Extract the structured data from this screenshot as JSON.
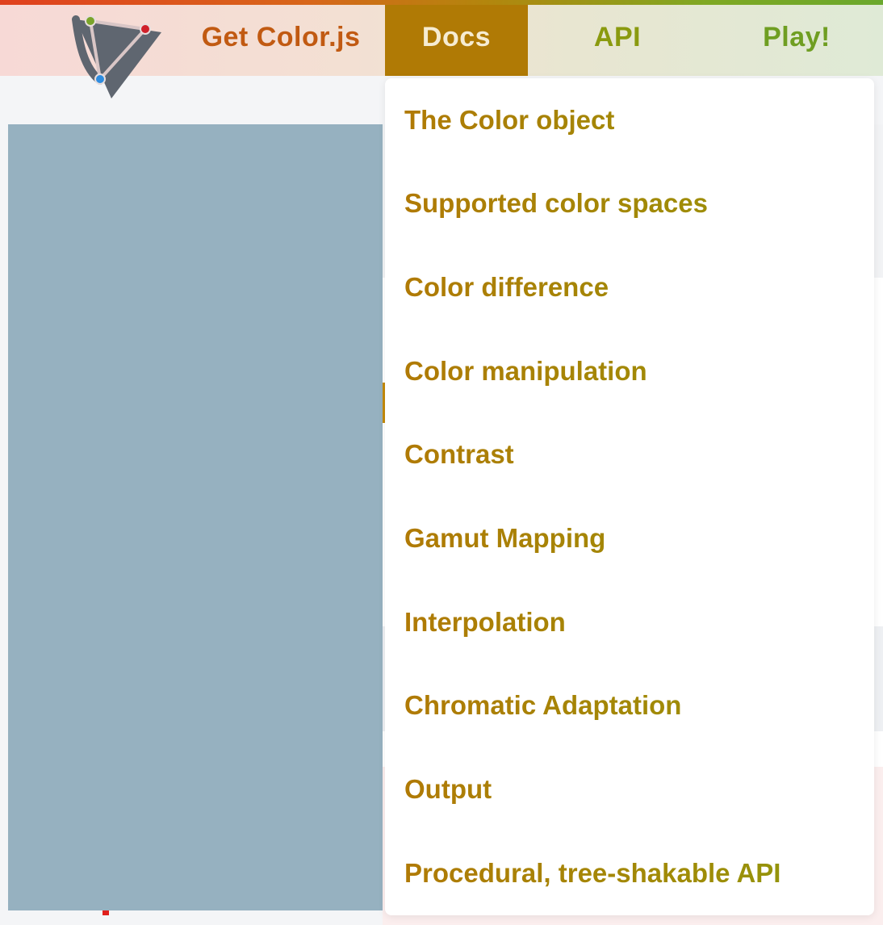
{
  "nav": {
    "brand_label": "Get Color.js",
    "items": [
      {
        "label": "Docs",
        "active": true
      },
      {
        "label": "API",
        "active": false
      },
      {
        "label": "Play!",
        "active": false
      }
    ]
  },
  "docs_menu": {
    "items": [
      {
        "label": "The Color object"
      },
      {
        "label": "Supported color spaces"
      },
      {
        "label": "Color difference"
      },
      {
        "label": "Color manipulation"
      },
      {
        "label": "Contrast"
      },
      {
        "label": "Gamut Mapping"
      },
      {
        "label": "Interpolation"
      },
      {
        "label": "Chromatic Adaptation"
      },
      {
        "label": "Output"
      },
      {
        "label": "Procedural, tree-shakable API"
      }
    ]
  },
  "colors": {
    "active_tab_bg": "#b07a05",
    "brand_text": "#c15a12",
    "menu_text_start": "#b07a05",
    "menu_text_end": "#8a9a10",
    "placeholder_panel": "#96b1c0"
  },
  "icons": {
    "logo": "color-js-logo-icon"
  }
}
